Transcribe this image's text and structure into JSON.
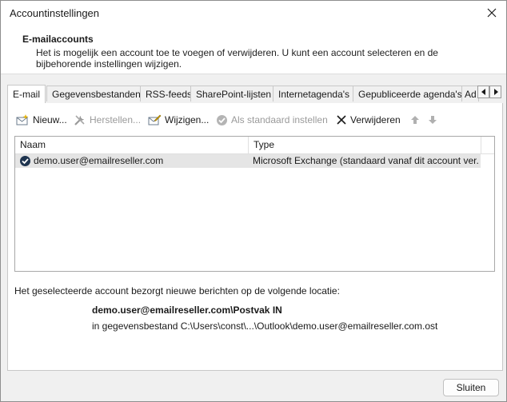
{
  "window": {
    "title": "Accountinstellingen"
  },
  "header": {
    "title": "E-mailaccounts",
    "description": "Het is mogelijk een account toe te voegen of verwijderen. U kunt een account selecteren en de bijbehorende instellingen wijzigen."
  },
  "tabs": [
    {
      "label": "E-mail",
      "active": true
    },
    {
      "label": "Gegevensbestanden",
      "active": false
    },
    {
      "label": "RSS-feeds",
      "active": false
    },
    {
      "label": "SharePoint-lijsten",
      "active": false
    },
    {
      "label": "Internetagenda's",
      "active": false
    },
    {
      "label": "Gepubliceerde agenda's",
      "active": false
    },
    {
      "label": "Ad",
      "active": false
    }
  ],
  "toolbar": {
    "new": "Nieuw...",
    "repair": "Herstellen...",
    "change": "Wijzigen...",
    "set_default": "Als standaard instellen",
    "remove": "Verwijderen"
  },
  "list": {
    "columns": [
      "Naam",
      "Type"
    ],
    "rows": [
      {
        "name": "demo.user@emailreseller.com",
        "type": "Microsoft Exchange (standaard vanaf dit account ver..."
      }
    ]
  },
  "info": {
    "label": "Het geselecteerde account bezorgt nieuwe berichten op de volgende locatie:",
    "folder": "demo.user@emailreseller.com\\Postvak IN",
    "datafile": "in gegevensbestand C:\\Users\\const\\...\\Outlook\\demo.user@emailreseller.com.ost"
  },
  "footer": {
    "close_label": "Sluiten"
  },
  "colors": {
    "selected_row": "#e5e5e5",
    "window_bg": "#f0f0f0"
  }
}
